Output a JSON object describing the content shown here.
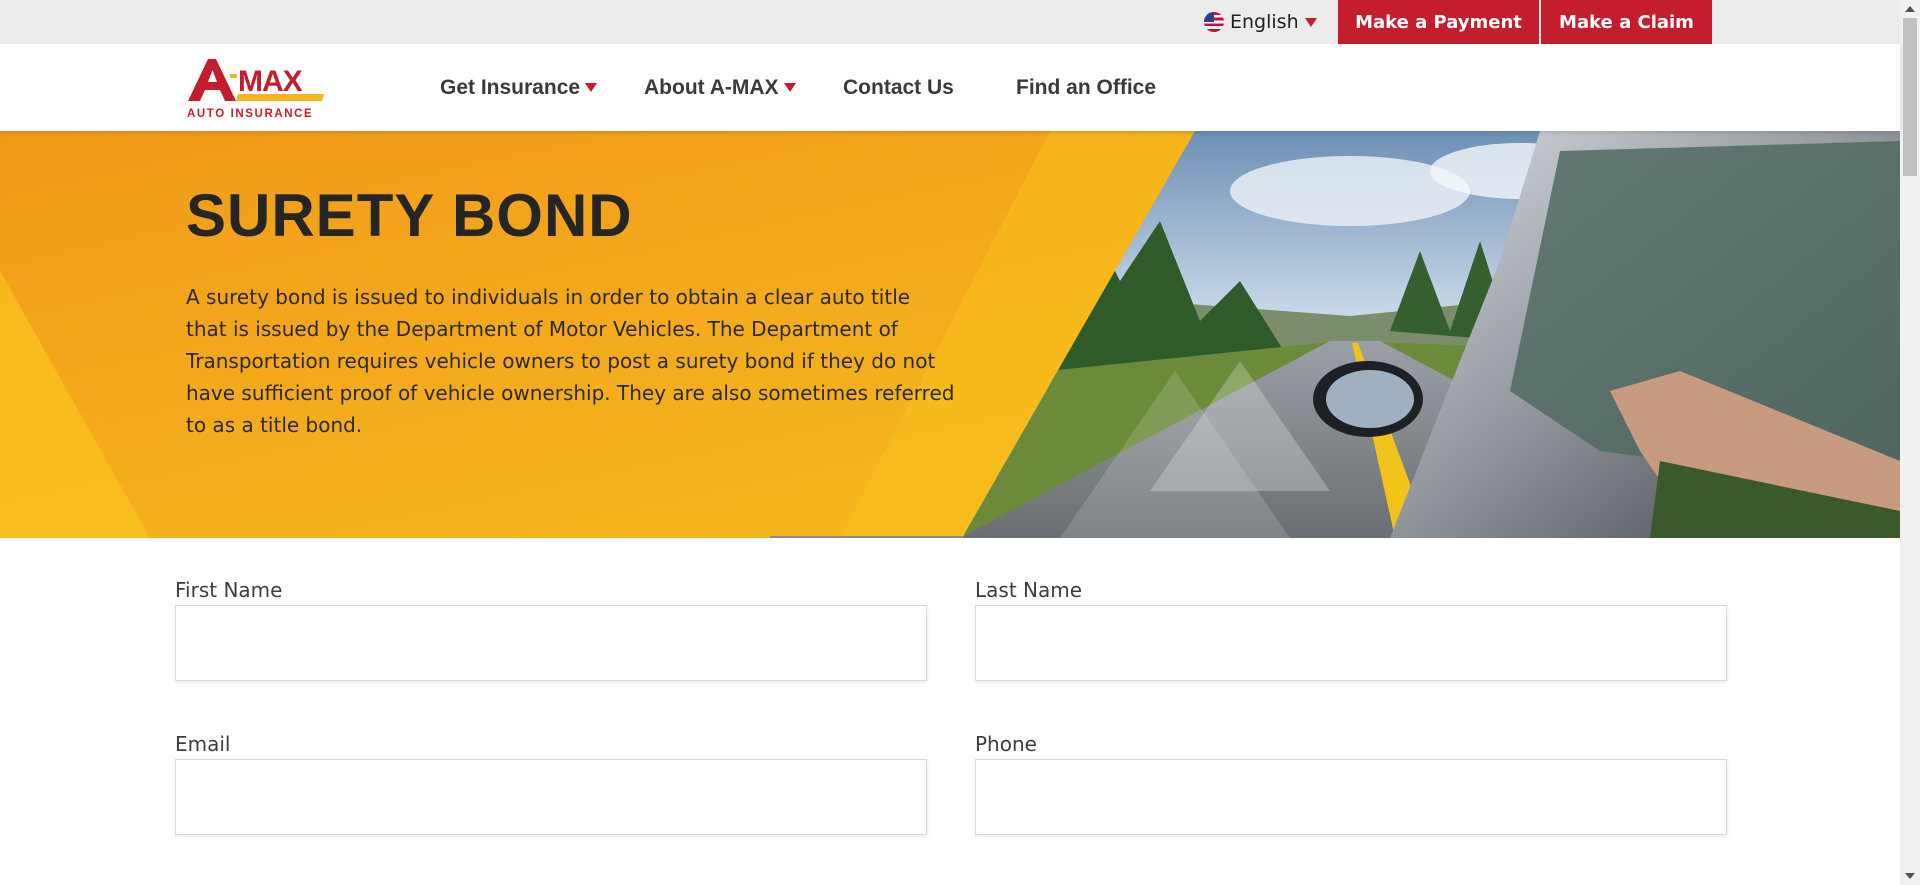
{
  "topbar": {
    "language": "English",
    "flag_icon": "us-flag-icon",
    "make_payment": "Make a Payment",
    "make_claim": "Make a Claim"
  },
  "logo": {
    "brand": "A-MAX",
    "tagline": "AUTO INSURANCE"
  },
  "nav": {
    "get_insurance": "Get Insurance",
    "about": "About A-MAX",
    "contact": "Contact Us",
    "find_office": "Find an Office"
  },
  "hero": {
    "title": "SURETY BOND",
    "description": "A surety bond is issued to individuals in order to obtain a clear auto title that is issued by the Department of Motor Vehicles. The Department of Transportation requires vehicle owners to post a surety bond if they do not have sufficient proof of vehicle ownership. They are also sometimes referred to as a title bond."
  },
  "form": {
    "first_name_label": "First Name",
    "first_name_value": "",
    "last_name_label": "Last Name",
    "last_name_value": "",
    "email_label": "Email",
    "email_value": "",
    "phone_label": "Phone",
    "phone_value": ""
  },
  "colors": {
    "brand_red": "#c41e2e",
    "hero_yellow": "#f6b520",
    "topbar_gray": "#ececec"
  }
}
